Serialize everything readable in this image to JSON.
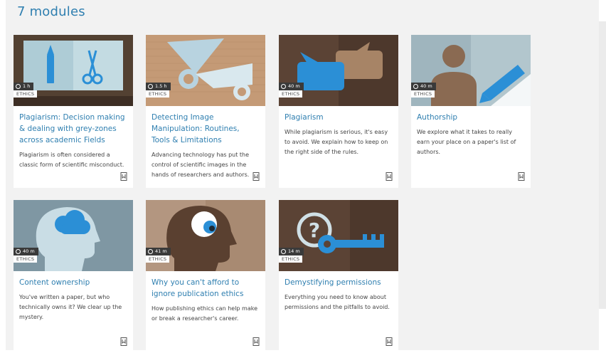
{
  "heading": "7 modules",
  "modules": [
    {
      "duration": "1 h",
      "tag": "ETHICS",
      "title": "Plagiarism: Decision making & dealing with grey-zones across academic Fields",
      "description": "Plagiarism is often considered a classic form of scientific misconduct.",
      "icon": "pen-scissors"
    },
    {
      "duration": "1.5 h",
      "tag": "ETHICS",
      "title": "Detecting Image Manipulation: Routines, Tools & Limitations",
      "description": "Advancing technology has put the control of scientific images in the hands of researchers and authors.",
      "icon": "scissors"
    },
    {
      "duration": "40 m",
      "tag": "ETHICS",
      "title": "Plagiarism",
      "description": "While plagiarism is serious, it's easy to avoid. We explain how to keep on the right side of the rules.",
      "icon": "speech-bubbles"
    },
    {
      "duration": "40 m",
      "tag": "ETHICS",
      "title": "Authorship",
      "description": "We explore what it takes to really earn your place on a paper's list of authors.",
      "icon": "person-pen"
    },
    {
      "duration": "40 m",
      "tag": "ETHICS",
      "title": "Content ownership",
      "description": "You've written a paper, but who technically owns it? We clear up the mystery.",
      "icon": "head-cloud"
    },
    {
      "duration": "41 m",
      "tag": "ETHICS",
      "title": "Why you can't afford to ignore publication ethics",
      "description": "How publishing ethics can help make or break a researcher's career.",
      "icon": "head-eye"
    },
    {
      "duration": "14 m",
      "tag": "ETHICS",
      "title": "Demystifying permissions",
      "description": "Everything you need to know about permissions and the pitfalls to avoid.",
      "icon": "question-key"
    }
  ]
}
